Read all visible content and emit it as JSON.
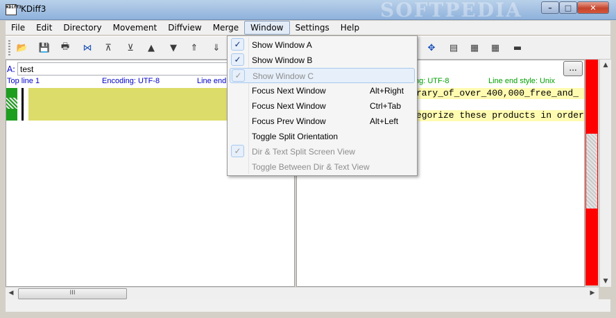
{
  "window": {
    "title": "KDiff3",
    "icon_text": "KDiff3",
    "watermark": "SOFTPEDIA",
    "controls": {
      "minimize": "–",
      "maximize": "□",
      "close": "✕"
    }
  },
  "menubar": [
    "File",
    "Edit",
    "Directory",
    "Movement",
    "Diffview",
    "Merge",
    "Window",
    "Settings",
    "Help"
  ],
  "open_menu": "Window",
  "toolbar": {
    "icons": [
      "open-icon",
      "save-icon",
      "print-icon",
      "auto-solve-icon",
      "go-top-icon",
      "go-bottom-icon",
      "prev-delta-icon",
      "next-delta-icon",
      "prev-conflict-icon",
      "next-conflict-icon",
      "split-view-icon",
      "dir-view-icon",
      "window-a-icon",
      "window-b-icon",
      "window-c-icon",
      "overview-icon"
    ],
    "glyphs": [
      "📂",
      "💾",
      "🖶",
      "⋈",
      "⊼",
      "⊻",
      "▲",
      "▼",
      "⇑",
      "⇓",
      "✥",
      "▤",
      "▦",
      "▦",
      "▦",
      "▬"
    ]
  },
  "left_pane": {
    "label": "A:",
    "file": "test",
    "info": {
      "top_line": "Top line 1",
      "encoding": "Encoding: UTF-8",
      "line_end": "Line end"
    }
  },
  "right_pane": {
    "browse": "...",
    "info": {
      "encoding": "ng: UTF-8",
      "line_end": "Line end style: Unix"
    },
    "lines": [
      "rary_of_over_400,000_free_and_",
      "egorize these products in order"
    ]
  },
  "hscroll_thumb": "III",
  "window_menu": [
    {
      "label": "Show Window A",
      "checked": true,
      "enabled": true,
      "shortcut": ""
    },
    {
      "label": "Show Window B",
      "checked": true,
      "enabled": true,
      "shortcut": ""
    },
    {
      "label": "Show Window C",
      "checked": true,
      "enabled": false,
      "shortcut": "",
      "hover": true
    },
    {
      "label": "Focus Next Window",
      "checked": false,
      "enabled": true,
      "shortcut": "Alt+Right"
    },
    {
      "label": "Focus Next Window",
      "checked": false,
      "enabled": true,
      "shortcut": "Ctrl+Tab"
    },
    {
      "label": "Focus Prev Window",
      "checked": false,
      "enabled": true,
      "shortcut": "Alt+Left"
    },
    {
      "label": "Toggle Split Orientation",
      "checked": false,
      "enabled": true,
      "shortcut": ""
    },
    {
      "label": "Dir & Text Split Screen View",
      "checked": true,
      "enabled": false,
      "shortcut": ""
    },
    {
      "label": "Toggle Between Dir & Text View",
      "checked": false,
      "enabled": false,
      "shortcut": ""
    }
  ],
  "check_glyph": "✓",
  "colors": {
    "diff_yellow": "#dcdc6a",
    "overview_red": "#ff0000",
    "file_label_blue": "#0000c8",
    "status_green": "#00a000"
  }
}
